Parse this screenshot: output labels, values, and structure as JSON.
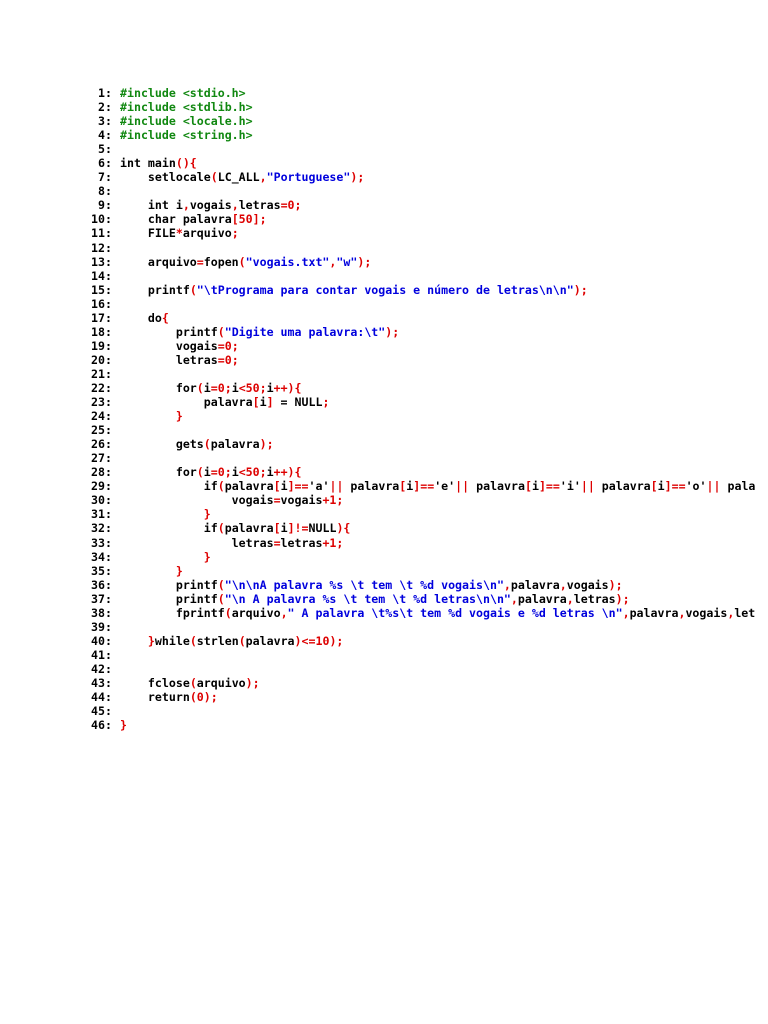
{
  "colors": {
    "default": "#000000",
    "preprocessor": "#118811",
    "operator": "#dd0000",
    "string": "#0000dd"
  },
  "lines": [
    {
      "n": "1:",
      "tokens": [
        {
          "t": "#include <stdio.h>",
          "c": "p"
        }
      ]
    },
    {
      "n": "2:",
      "tokens": [
        {
          "t": "#include <stdlib.h>",
          "c": "p"
        }
      ]
    },
    {
      "n": "3:",
      "tokens": [
        {
          "t": "#include <locale.h>",
          "c": "p"
        }
      ]
    },
    {
      "n": "4:",
      "tokens": [
        {
          "t": "#include <string.h>",
          "c": "p"
        }
      ]
    },
    {
      "n": "5:",
      "tokens": []
    },
    {
      "n": "6:",
      "tokens": [
        {
          "t": "int main",
          "c": "d"
        },
        {
          "t": "(){",
          "c": "o"
        }
      ]
    },
    {
      "n": "7:",
      "tokens": [
        {
          "t": "    setlocale",
          "c": "d"
        },
        {
          "t": "(",
          "c": "o"
        },
        {
          "t": "LC_ALL",
          "c": "d"
        },
        {
          "t": ",",
          "c": "o"
        },
        {
          "t": "\"Portuguese\"",
          "c": "s"
        },
        {
          "t": ");",
          "c": "o"
        }
      ]
    },
    {
      "n": "8:",
      "tokens": []
    },
    {
      "n": "9:",
      "tokens": [
        {
          "t": "    int i",
          "c": "d"
        },
        {
          "t": ",",
          "c": "o"
        },
        {
          "t": "vogais",
          "c": "d"
        },
        {
          "t": ",",
          "c": "o"
        },
        {
          "t": "letras",
          "c": "d"
        },
        {
          "t": "=0;",
          "c": "o"
        }
      ]
    },
    {
      "n": "10:",
      "tokens": [
        {
          "t": "    char palavra",
          "c": "d"
        },
        {
          "t": "[50];",
          "c": "o"
        }
      ]
    },
    {
      "n": "11:",
      "tokens": [
        {
          "t": "    FILE",
          "c": "d"
        },
        {
          "t": "*",
          "c": "o"
        },
        {
          "t": "arquivo",
          "c": "d"
        },
        {
          "t": ";",
          "c": "o"
        }
      ]
    },
    {
      "n": "12:",
      "tokens": []
    },
    {
      "n": "13:",
      "tokens": [
        {
          "t": "    arquivo",
          "c": "d"
        },
        {
          "t": "=",
          "c": "o"
        },
        {
          "t": "fopen",
          "c": "d"
        },
        {
          "t": "(",
          "c": "o"
        },
        {
          "t": "\"vogais.txt\"",
          "c": "s"
        },
        {
          "t": ",",
          "c": "o"
        },
        {
          "t": "\"w\"",
          "c": "s"
        },
        {
          "t": ");",
          "c": "o"
        }
      ]
    },
    {
      "n": "14:",
      "tokens": []
    },
    {
      "n": "15:",
      "tokens": [
        {
          "t": "    printf",
          "c": "d"
        },
        {
          "t": "(",
          "c": "o"
        },
        {
          "t": "\"\\tPrograma para contar vogais e número de letras\\n\\n\"",
          "c": "s"
        },
        {
          "t": ");",
          "c": "o"
        }
      ]
    },
    {
      "n": "16:",
      "tokens": []
    },
    {
      "n": "17:",
      "tokens": [
        {
          "t": "    do",
          "c": "d"
        },
        {
          "t": "{",
          "c": "o"
        }
      ]
    },
    {
      "n": "18:",
      "tokens": [
        {
          "t": "        printf",
          "c": "d"
        },
        {
          "t": "(",
          "c": "o"
        },
        {
          "t": "\"Digite uma palavra:\\t\"",
          "c": "s"
        },
        {
          "t": ");",
          "c": "o"
        }
      ]
    },
    {
      "n": "19:",
      "tokens": [
        {
          "t": "        vogais",
          "c": "d"
        },
        {
          "t": "=0;",
          "c": "o"
        }
      ]
    },
    {
      "n": "20:",
      "tokens": [
        {
          "t": "        letras",
          "c": "d"
        },
        {
          "t": "=0;",
          "c": "o"
        }
      ]
    },
    {
      "n": "21:",
      "tokens": []
    },
    {
      "n": "22:",
      "tokens": [
        {
          "t": "        for",
          "c": "d"
        },
        {
          "t": "(",
          "c": "o"
        },
        {
          "t": "i",
          "c": "d"
        },
        {
          "t": "=0;",
          "c": "o"
        },
        {
          "t": "i",
          "c": "d"
        },
        {
          "t": "<50;",
          "c": "o"
        },
        {
          "t": "i",
          "c": "d"
        },
        {
          "t": "++){",
          "c": "o"
        }
      ]
    },
    {
      "n": "23:",
      "tokens": [
        {
          "t": "            palavra",
          "c": "d"
        },
        {
          "t": "[",
          "c": "o"
        },
        {
          "t": "i",
          "c": "d"
        },
        {
          "t": "]",
          "c": "o"
        },
        {
          "t": " = NULL",
          "c": "d"
        },
        {
          "t": ";",
          "c": "o"
        }
      ]
    },
    {
      "n": "24:",
      "tokens": [
        {
          "t": "        }",
          "c": "o"
        }
      ]
    },
    {
      "n": "25:",
      "tokens": []
    },
    {
      "n": "26:",
      "tokens": [
        {
          "t": "        gets",
          "c": "d"
        },
        {
          "t": "(",
          "c": "o"
        },
        {
          "t": "palavra",
          "c": "d"
        },
        {
          "t": ");",
          "c": "o"
        }
      ]
    },
    {
      "n": "27:",
      "tokens": []
    },
    {
      "n": "28:",
      "tokens": [
        {
          "t": "        for",
          "c": "d"
        },
        {
          "t": "(",
          "c": "o"
        },
        {
          "t": "i",
          "c": "d"
        },
        {
          "t": "=0;",
          "c": "o"
        },
        {
          "t": "i",
          "c": "d"
        },
        {
          "t": "<50;",
          "c": "o"
        },
        {
          "t": "i",
          "c": "d"
        },
        {
          "t": "++){",
          "c": "o"
        }
      ]
    },
    {
      "n": "29:",
      "tokens": [
        {
          "t": "            if",
          "c": "d"
        },
        {
          "t": "(",
          "c": "o"
        },
        {
          "t": "palavra",
          "c": "d"
        },
        {
          "t": "[",
          "c": "o"
        },
        {
          "t": "i",
          "c": "d"
        },
        {
          "t": "]==",
          "c": "o"
        },
        {
          "t": "'a'",
          "c": "d"
        },
        {
          "t": "||",
          "c": "o"
        },
        {
          "t": " palavra",
          "c": "d"
        },
        {
          "t": "[",
          "c": "o"
        },
        {
          "t": "i",
          "c": "d"
        },
        {
          "t": "]==",
          "c": "o"
        },
        {
          "t": "'e'",
          "c": "d"
        },
        {
          "t": "||",
          "c": "o"
        },
        {
          "t": " palavra",
          "c": "d"
        },
        {
          "t": "[",
          "c": "o"
        },
        {
          "t": "i",
          "c": "d"
        },
        {
          "t": "]==",
          "c": "o"
        },
        {
          "t": "'i'",
          "c": "d"
        },
        {
          "t": "||",
          "c": "o"
        },
        {
          "t": " palavra",
          "c": "d"
        },
        {
          "t": "[",
          "c": "o"
        },
        {
          "t": "i",
          "c": "d"
        },
        {
          "t": "]==",
          "c": "o"
        },
        {
          "t": "'o'",
          "c": "d"
        },
        {
          "t": "||",
          "c": "o"
        },
        {
          "t": " pala",
          "c": "d"
        }
      ]
    },
    {
      "n": "30:",
      "tokens": [
        {
          "t": "                vogais",
          "c": "d"
        },
        {
          "t": "=",
          "c": "o"
        },
        {
          "t": "vogais",
          "c": "d"
        },
        {
          "t": "+1;",
          "c": "o"
        }
      ]
    },
    {
      "n": "31:",
      "tokens": [
        {
          "t": "            }",
          "c": "o"
        }
      ]
    },
    {
      "n": "32:",
      "tokens": [
        {
          "t": "            if",
          "c": "d"
        },
        {
          "t": "(",
          "c": "o"
        },
        {
          "t": "palavra",
          "c": "d"
        },
        {
          "t": "[",
          "c": "o"
        },
        {
          "t": "i",
          "c": "d"
        },
        {
          "t": "]!=",
          "c": "o"
        },
        {
          "t": "NULL",
          "c": "d"
        },
        {
          "t": "){",
          "c": "o"
        }
      ]
    },
    {
      "n": "33:",
      "tokens": [
        {
          "t": "                letras",
          "c": "d"
        },
        {
          "t": "=",
          "c": "o"
        },
        {
          "t": "letras",
          "c": "d"
        },
        {
          "t": "+1;",
          "c": "o"
        }
      ]
    },
    {
      "n": "34:",
      "tokens": [
        {
          "t": "            }",
          "c": "o"
        }
      ]
    },
    {
      "n": "35:",
      "tokens": [
        {
          "t": "        }",
          "c": "o"
        }
      ]
    },
    {
      "n": "36:",
      "tokens": [
        {
          "t": "        printf",
          "c": "d"
        },
        {
          "t": "(",
          "c": "o"
        },
        {
          "t": "\"\\n\\nA palavra %s \\t tem \\t %d vogais\\n\"",
          "c": "s"
        },
        {
          "t": ",",
          "c": "o"
        },
        {
          "t": "palavra",
          "c": "d"
        },
        {
          "t": ",",
          "c": "o"
        },
        {
          "t": "vogais",
          "c": "d"
        },
        {
          "t": ");",
          "c": "o"
        }
      ]
    },
    {
      "n": "37:",
      "tokens": [
        {
          "t": "        printf",
          "c": "d"
        },
        {
          "t": "(",
          "c": "o"
        },
        {
          "t": "\"\\n A palavra %s \\t tem \\t %d letras\\n\\n\"",
          "c": "s"
        },
        {
          "t": ",",
          "c": "o"
        },
        {
          "t": "palavra",
          "c": "d"
        },
        {
          "t": ",",
          "c": "o"
        },
        {
          "t": "letras",
          "c": "d"
        },
        {
          "t": ");",
          "c": "o"
        }
      ]
    },
    {
      "n": "38:",
      "tokens": [
        {
          "t": "        fprintf",
          "c": "d"
        },
        {
          "t": "(",
          "c": "o"
        },
        {
          "t": "arquivo",
          "c": "d"
        },
        {
          "t": ",",
          "c": "o"
        },
        {
          "t": "\" A palavra \\t%s\\t tem %d vogais e %d letras \\n\"",
          "c": "s"
        },
        {
          "t": ",",
          "c": "o"
        },
        {
          "t": "palavra",
          "c": "d"
        },
        {
          "t": ",",
          "c": "o"
        },
        {
          "t": "vogais",
          "c": "d"
        },
        {
          "t": ",",
          "c": "o"
        },
        {
          "t": "let",
          "c": "d"
        }
      ]
    },
    {
      "n": "39:",
      "tokens": []
    },
    {
      "n": "40:",
      "tokens": [
        {
          "t": "    }",
          "c": "o"
        },
        {
          "t": "while",
          "c": "d"
        },
        {
          "t": "(",
          "c": "o"
        },
        {
          "t": "strlen",
          "c": "d"
        },
        {
          "t": "(",
          "c": "o"
        },
        {
          "t": "palavra",
          "c": "d"
        },
        {
          "t": ")<=10);",
          "c": "o"
        }
      ]
    },
    {
      "n": "41:",
      "tokens": []
    },
    {
      "n": "42:",
      "tokens": []
    },
    {
      "n": "43:",
      "tokens": [
        {
          "t": "    fclose",
          "c": "d"
        },
        {
          "t": "(",
          "c": "o"
        },
        {
          "t": "arquivo",
          "c": "d"
        },
        {
          "t": ");",
          "c": "o"
        }
      ]
    },
    {
      "n": "44:",
      "tokens": [
        {
          "t": "    return",
          "c": "d"
        },
        {
          "t": "(0);",
          "c": "o"
        }
      ]
    },
    {
      "n": "45:",
      "tokens": []
    },
    {
      "n": "46:",
      "tokens": [
        {
          "t": "}",
          "c": "o"
        }
      ]
    }
  ]
}
